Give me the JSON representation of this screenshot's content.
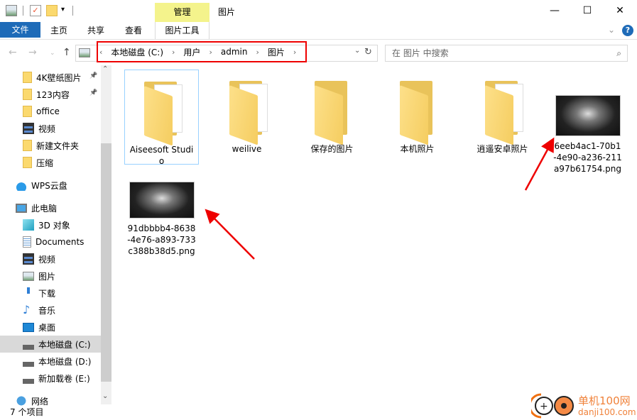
{
  "window": {
    "title": "图片",
    "manage_tab": "管理",
    "minimize": "—",
    "maximize": "☐",
    "close": "✕"
  },
  "ribbon": {
    "tabs": [
      "文件",
      "主页",
      "共享",
      "查看",
      "图片工具"
    ],
    "collapse": "⌄",
    "help": "?"
  },
  "address": {
    "crumbs": [
      "本地磁盘 (C:)",
      "用户",
      "admin",
      "图片"
    ],
    "search_placeholder": "在 图片 中搜索"
  },
  "nav": {
    "items": [
      {
        "label": "4K壁纸图片",
        "icon": "folder-icon",
        "pinned": true
      },
      {
        "label": "123内容",
        "icon": "folder-icon",
        "pinned": true
      },
      {
        "label": "office",
        "icon": "folder-icon"
      },
      {
        "label": "视频",
        "icon": "video-icon"
      },
      {
        "label": "新建文件夹",
        "icon": "folder-icon"
      },
      {
        "label": "压缩",
        "icon": "folder-icon"
      },
      {
        "label": "WPS云盘",
        "icon": "cloud-icon"
      },
      {
        "label": "此电脑",
        "icon": "computer-icon"
      },
      {
        "label": "3D 对象",
        "icon": "cube-icon"
      },
      {
        "label": "Documents",
        "icon": "document-icon"
      },
      {
        "label": "视频",
        "icon": "video-icon"
      },
      {
        "label": "图片",
        "icon": "picture-icon"
      },
      {
        "label": "下载",
        "icon": "download-icon"
      },
      {
        "label": "音乐",
        "icon": "music-icon"
      },
      {
        "label": "桌面",
        "icon": "desktop-icon"
      },
      {
        "label": "本地磁盘 (C:)",
        "icon": "drive-icon",
        "selected": true
      },
      {
        "label": "本地磁盘 (D:)",
        "icon": "drive-icon"
      },
      {
        "label": "新加载卷 (E:)",
        "icon": "drive-icon"
      },
      {
        "label": "网络",
        "icon": "network-icon"
      }
    ]
  },
  "files": [
    {
      "name": "Aiseesoft Studio",
      "type": "folder"
    },
    {
      "name": "weilive",
      "type": "folder"
    },
    {
      "name": "保存的图片",
      "type": "folder"
    },
    {
      "name": "本机照片",
      "type": "folder"
    },
    {
      "name": "逍遥安卓照片",
      "type": "folder"
    },
    {
      "name": "6eeb4ac1-70b1-4e90-a236-211a97b61754.png",
      "type": "image"
    },
    {
      "name": "91dbbbb4-8638-4e76-a893-733c388b38d5.png",
      "type": "image"
    }
  ],
  "status": {
    "count": "7 个项目"
  },
  "watermark": {
    "text": "单机100网",
    "url_text": "danji100.com"
  },
  "colors": {
    "accent": "#1e6bb8",
    "highlight": "#e00000",
    "manage": "#f4f38c"
  }
}
